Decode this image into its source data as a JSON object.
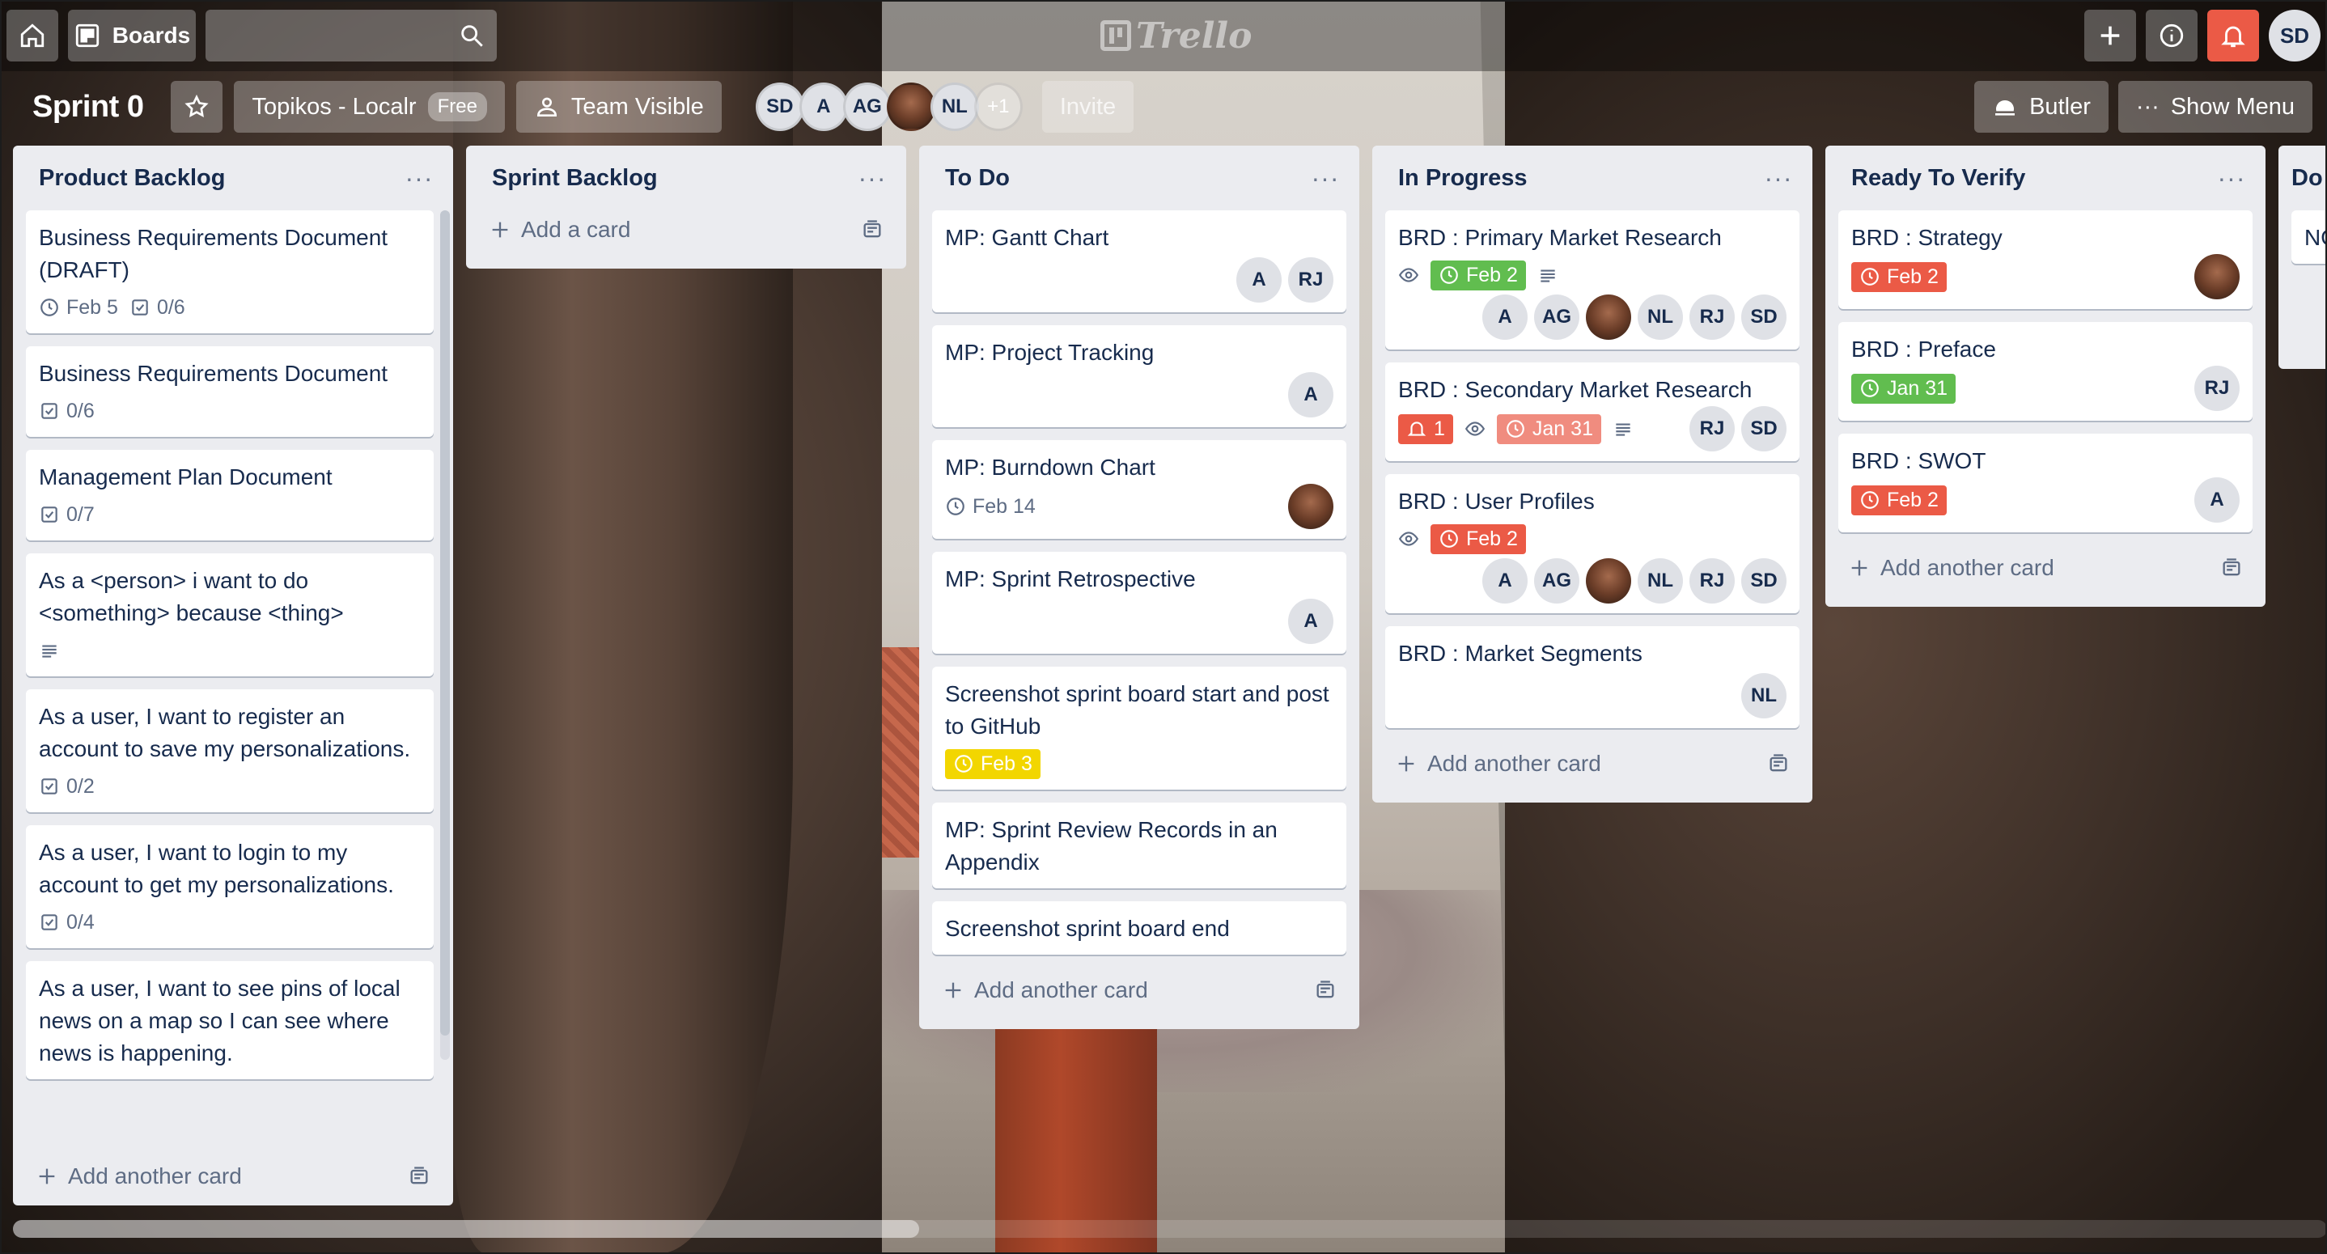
{
  "header": {
    "boards_label": "Boards",
    "search_placeholder": "",
    "logo_text": "Trello",
    "user_initials": "SD"
  },
  "board": {
    "title": "Sprint 0",
    "team_name": "Topikos - Localr",
    "plan_badge": "Free",
    "visibility_label": "Team Visible",
    "members": [
      "SD",
      "A",
      "AG",
      "",
      "NL"
    ],
    "more_members": "+1",
    "invite_label": "Invite",
    "butler_label": "Butler",
    "show_menu_label": "Show Menu"
  },
  "lists": [
    {
      "title": "Product Backlog",
      "add_label": "Add another card",
      "cards": [
        {
          "title": "Business Requirements Document (DRAFT)",
          "due": "Feb 5",
          "checklist": "0/6"
        },
        {
          "title": "Business Requirements Document",
          "checklist": "0/6"
        },
        {
          "title": "Management Plan Document",
          "checklist": "0/7"
        },
        {
          "title": "As a <person> i want to do <something> because <thing>"
        },
        {
          "title": "As a user, I want to register an account to save my personalizations.",
          "checklist": "0/2"
        },
        {
          "title": "As a user, I want to login to my account to get my personalizations.",
          "checklist": "0/4"
        },
        {
          "title": "As a user, I want to see pins of local news on a map so I can see where news is happening."
        }
      ]
    },
    {
      "title": "Sprint Backlog",
      "add_label": "Add a card",
      "cards": []
    },
    {
      "title": "To Do",
      "add_label": "Add another card",
      "cards": [
        {
          "title": "MP: Gantt Chart",
          "members": [
            "A",
            "RJ"
          ]
        },
        {
          "title": "MP: Project Tracking",
          "members": [
            "A"
          ]
        },
        {
          "title": "MP: Burndown Chart",
          "due": "Feb 14"
        },
        {
          "title": "MP: Sprint Retrospective",
          "members": [
            "A"
          ]
        },
        {
          "title": "Screenshot sprint board start and post to GitHub",
          "due": "Feb 3"
        },
        {
          "title": "MP: Sprint Review Records in an Appendix"
        },
        {
          "title": "Screenshot sprint board end"
        }
      ]
    },
    {
      "title": "In Progress",
      "add_label": "Add another card",
      "cards": [
        {
          "title": "BRD : Primary Market Research",
          "due": "Feb 2",
          "members": [
            "A",
            "AG",
            "",
            "NL",
            "RJ",
            "SD"
          ]
        },
        {
          "title": "BRD : Secondary Market Research",
          "notifications": "1",
          "due": "Jan 31",
          "members": [
            "RJ",
            "SD"
          ]
        },
        {
          "title": "BRD : User Profiles",
          "due": "Feb 2",
          "members": [
            "A",
            "AG",
            "",
            "NL",
            "RJ",
            "SD"
          ]
        },
        {
          "title": "BRD : Market Segments",
          "members": [
            "NL"
          ]
        }
      ]
    },
    {
      "title": "Ready To Verify",
      "add_label": "Add another card",
      "cards": [
        {
          "title": "BRD : Strategy",
          "due": "Feb 2"
        },
        {
          "title": "BRD : Preface",
          "due": "Jan 31",
          "members": [
            "RJ"
          ]
        },
        {
          "title": "BRD : SWOT",
          "due": "Feb 2",
          "members": [
            "A"
          ]
        }
      ]
    },
    {
      "title": "Do",
      "cards": [
        {
          "title": "NO pr"
        }
      ]
    }
  ],
  "colors": {
    "due_green": "#61bd4f",
    "due_red": "#eb5a46",
    "due_yellow": "#f2d600",
    "notification_red": "#eb5a46"
  }
}
